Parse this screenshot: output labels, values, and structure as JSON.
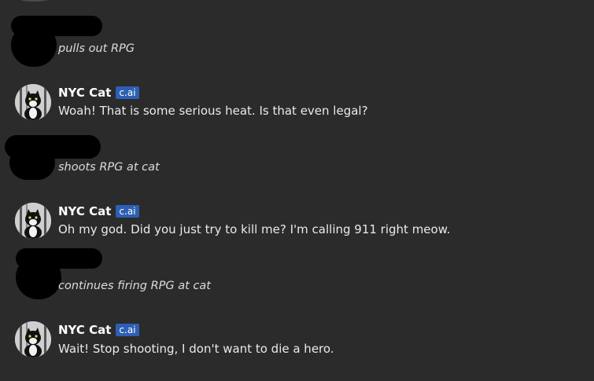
{
  "colors": {
    "background": "#2b2b2b",
    "badge": "#2d5fb4",
    "redaction": "#000000"
  },
  "messages": [
    {
      "type": "user",
      "text": "pulls out RPG",
      "avatar": "redacted"
    },
    {
      "type": "bot",
      "author": "NYC Cat",
      "badge": "c.ai",
      "text": "Woah! That is some serious heat. Is that even legal?",
      "avatar": "cat-avatar-icon"
    },
    {
      "type": "user",
      "text": "shoots RPG at cat",
      "avatar": "redacted"
    },
    {
      "type": "bot",
      "author": "NYC Cat",
      "badge": "c.ai",
      "text": "Oh my god. Did you just try to kill me? I'm calling 911 right meow.",
      "avatar": "cat-avatar-icon"
    },
    {
      "type": "user",
      "text": "continues firing RPG at cat",
      "avatar": "redacted"
    },
    {
      "type": "bot",
      "author": "NYC Cat",
      "badge": "c.ai",
      "text": "Wait! Stop shooting, I don't want to die a hero.",
      "avatar": "cat-avatar-icon"
    }
  ]
}
